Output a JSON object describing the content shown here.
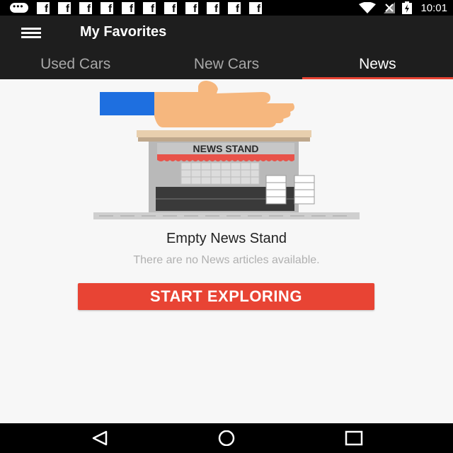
{
  "status_bar": {
    "time": "10:01",
    "notification_icons": [
      "message-icon",
      "facebook-icon",
      "facebook-icon",
      "facebook-icon",
      "facebook-icon",
      "facebook-icon",
      "facebook-icon",
      "facebook-icon",
      "facebook-icon",
      "facebook-icon",
      "facebook-icon",
      "facebook-icon"
    ],
    "status_icons": [
      "wifi-icon",
      "signal-icon",
      "battery-charging-icon"
    ]
  },
  "toolbar": {
    "title": "My Favorites",
    "menu_icon": "hamburger-menu-icon"
  },
  "tabs": [
    {
      "label": "Used Cars",
      "active": false
    },
    {
      "label": "New Cars",
      "active": false
    },
    {
      "label": "News",
      "active": true
    }
  ],
  "illustration": {
    "sign_text": "NEWS STAND"
  },
  "empty_state": {
    "title": "Empty News Stand",
    "subtitle": "There are no News articles available.",
    "button_label": "START EXPLORING"
  },
  "navigation_bar": {
    "icons": [
      "back-icon",
      "home-icon",
      "recents-icon"
    ]
  },
  "colors": {
    "accent": "#e84434",
    "toolbar": "#1e1e1e",
    "background": "#f7f7f7"
  }
}
